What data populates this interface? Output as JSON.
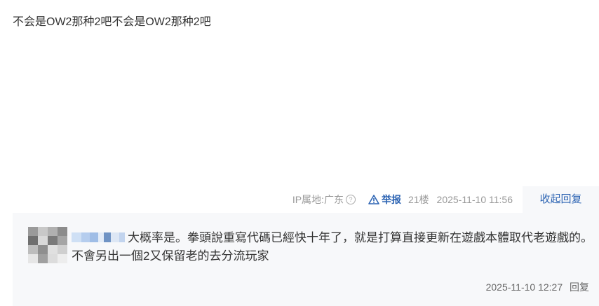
{
  "post": {
    "content": "不会是OW2那种2吧不会是OW2那种2吧"
  },
  "meta": {
    "ip_location": "IP属地:广东",
    "help_icon": "question-circle-icon",
    "report_icon": "warning-triangle-icon",
    "report_label": "举报",
    "floor": "21楼",
    "timestamp": "2025-11-10 11:56",
    "collapse_label": "收起回复"
  },
  "reply": {
    "avatar_icon": "blurred-avatar",
    "username_note": "pixelated-username",
    "text": "大概率是。拳頭說重寫代碼已經快十年了，就是打算直接更新在遊戲本體取代老遊戲的。不會另出一個2又保留老的去分流玩家",
    "timestamp": "2025-11-10 12:27",
    "reply_label": "回复"
  },
  "colors": {
    "link_blue": "#2d64b3",
    "meta_gray": "#999999",
    "reply_bg": "#f7f8fa",
    "text": "#333333"
  }
}
